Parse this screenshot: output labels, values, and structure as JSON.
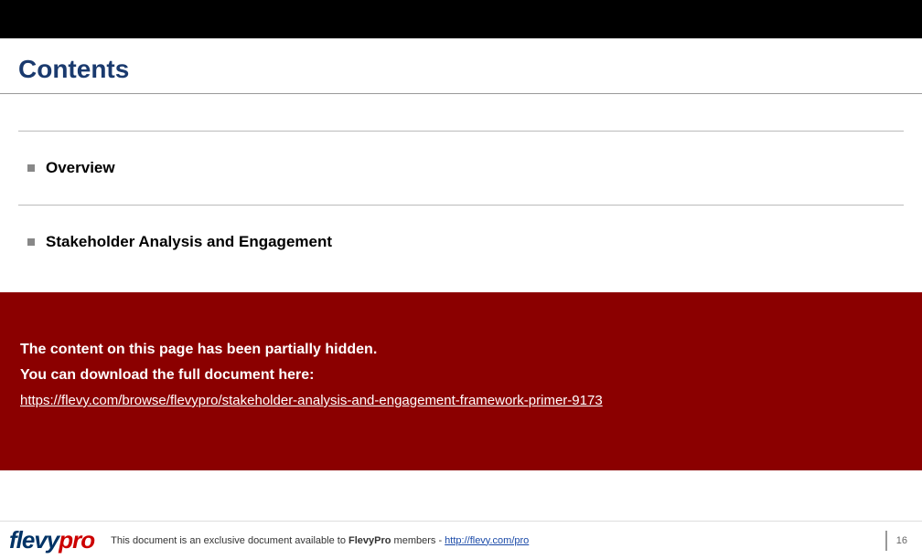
{
  "title": "Contents",
  "items": [
    {
      "label": "Overview"
    },
    {
      "label": "Stakeholder Analysis and Engagement"
    }
  ],
  "overlay": {
    "line1": "The content on this page has been partially hidden.",
    "line2": "You can download the full document here:",
    "link_text": "https://flevy.com/browse/flevypro/stakeholder-analysis-and-engagement-framework-primer-9173",
    "link_href": "https://flevy.com/browse/flevypro/stakeholder-analysis-and-engagement-framework-primer-9173"
  },
  "footer": {
    "logo_part1": "flevy",
    "logo_part2": "pro",
    "text_prefix": "This document is an exclusive document available to ",
    "text_bold": "FlevyPro",
    "text_suffix": " members - ",
    "link_text": "http://flevy.com/pro",
    "link_href": "http://flevy.com/pro",
    "page_number": "16"
  }
}
